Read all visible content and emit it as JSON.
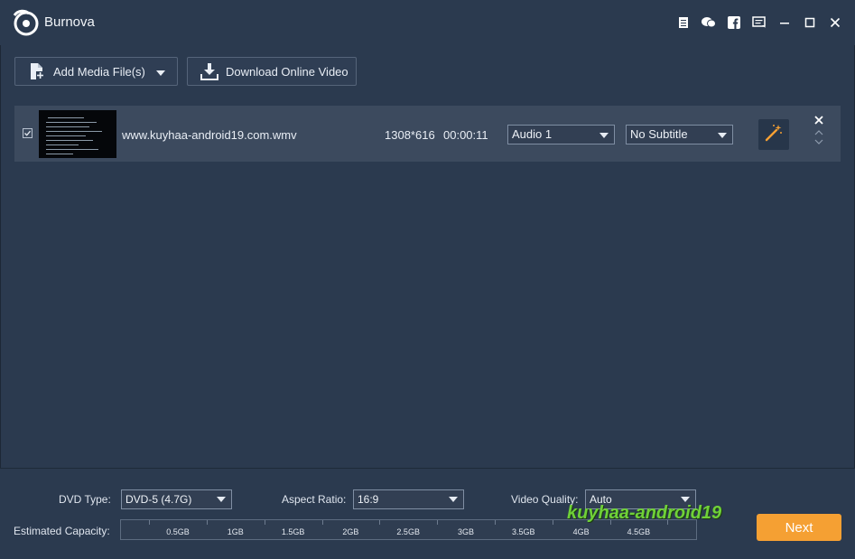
{
  "app": {
    "title": "Burnova"
  },
  "titlebar": {
    "icons": [
      "document-icon",
      "chat-icon",
      "facebook-icon",
      "feedback-icon",
      "minimize-icon",
      "maximize-icon",
      "close-icon"
    ]
  },
  "toolbar": {
    "add_media_label": "Add Media File(s)",
    "download_label": "Download Online Video"
  },
  "media": {
    "filename": "www.kuyhaa-android19.com.wmv",
    "resolution": "1308*616",
    "duration": "00:00:11",
    "audio_track": "Audio 1",
    "subtitle": "No Subtitle"
  },
  "bottom": {
    "dvd_type_label": "DVD Type:",
    "dvd_type_value": "DVD-5 (4.7G)",
    "aspect_ratio_label": "Aspect Ratio:",
    "aspect_ratio_value": "16:9",
    "video_quality_label": "Video Quality:",
    "video_quality_value": "Auto",
    "capacity_label": "Estimated Capacity:",
    "capacity_ticks": [
      "0.5GB",
      "1GB",
      "1.5GB",
      "2GB",
      "2.5GB",
      "3GB",
      "3.5GB",
      "4GB",
      "4.5GB"
    ],
    "next_label": "Next"
  },
  "watermark": {
    "text": "kuyhaa-android19"
  },
  "colors": {
    "background": "#2b3a4f",
    "row": "#3c4a5e",
    "accent": "#f5a033",
    "watermark": "#6fd138"
  }
}
